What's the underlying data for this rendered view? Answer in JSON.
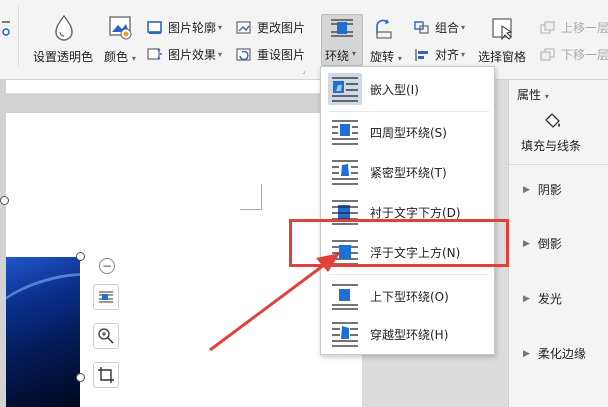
{
  "ribbon": {
    "set_transparent": "设置透明色",
    "color": "颜色",
    "pic_outline": "图片轮廓",
    "pic_effects": "图片效果",
    "change_pic": "更改图片",
    "reset_pic": "重设图片",
    "wrap": "环绕",
    "rotate": "旋转",
    "group": "组合",
    "align": "对齐",
    "selection_pane": "选择窗格",
    "bring_forward": "上移一层",
    "send_backward": "下移一层"
  },
  "wrap_menu": {
    "items": [
      {
        "label": "嵌入型(I)",
        "selected": true
      },
      {
        "label": "四周型环绕(S)"
      },
      {
        "label": "紧密型环绕(T)"
      },
      {
        "label": "衬于文字下方(D)"
      },
      {
        "label": "浮于文字上方(N)"
      },
      {
        "label": "上下型环绕(O)"
      },
      {
        "label": "穿越型环绕(H)"
      }
    ]
  },
  "panel": {
    "properties": "属性",
    "fill_line": "填充与线条",
    "sections": [
      "阴影",
      "倒影",
      "发光",
      "柔化边缘"
    ]
  },
  "colors": {
    "highlight": "#e2403c",
    "accent_blue": "#1f6fd6"
  }
}
